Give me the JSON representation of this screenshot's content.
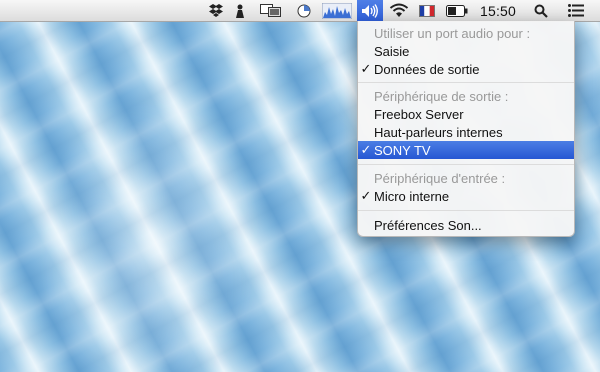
{
  "menubar": {
    "icons": [
      "dropbox-icon",
      "person-icon",
      "screen-sharing-icon",
      "time-machine-icon",
      "activity-monitor-icon",
      "volume-icon",
      "wifi-icon",
      "french-flag-icon",
      "battery-icon"
    ],
    "clock": "15:50",
    "right_icons": [
      "spotlight-icon",
      "notification-center-icon"
    ],
    "accent": "#2f5fd8"
  },
  "sound_menu": {
    "header_port": "Utiliser un port audio pour :",
    "port_items": [
      {
        "label": "Saisie",
        "checked": false
      },
      {
        "label": "Données de sortie",
        "checked": true
      }
    ],
    "header_output": "Périphérique de sortie :",
    "output_items": [
      {
        "label": "Freebox Server",
        "checked": false
      },
      {
        "label": "Haut-parleurs internes",
        "checked": false
      },
      {
        "label": "SONY TV",
        "checked": true,
        "highlighted": true
      }
    ],
    "header_input": "Périphérique d'entrée :",
    "input_items": [
      {
        "label": "Micro interne",
        "checked": true
      }
    ],
    "preferences": "Préférences Son...",
    "check_mark": "✓"
  }
}
